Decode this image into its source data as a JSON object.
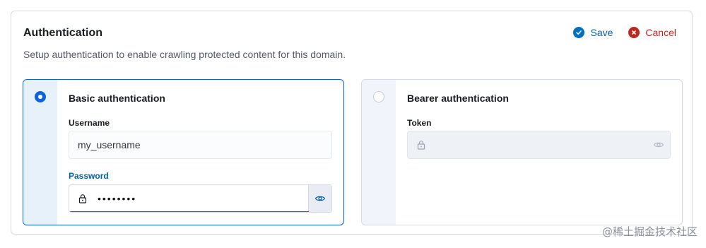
{
  "header": {
    "title": "Authentication",
    "description": "Setup authentication to enable crawling protected content for this domain.",
    "save_label": "Save",
    "cancel_label": "Cancel"
  },
  "basic": {
    "title": "Basic authentication",
    "selected": true,
    "username_label": "Username",
    "username_value": "my_username",
    "password_label": "Password",
    "password_value": "••••••••"
  },
  "bearer": {
    "title": "Bearer authentication",
    "selected": false,
    "token_label": "Token",
    "token_value": ""
  },
  "watermark": "@稀土掘金技术社区",
  "colors": {
    "primary": "#0b64dd",
    "save": "#0061a6",
    "danger": "#bd271e",
    "border": "#d3dae6"
  },
  "icons": {
    "save": "check-circle-icon",
    "cancel": "cross-circle-icon",
    "lock": "lock-icon",
    "eye": "eye-icon"
  }
}
